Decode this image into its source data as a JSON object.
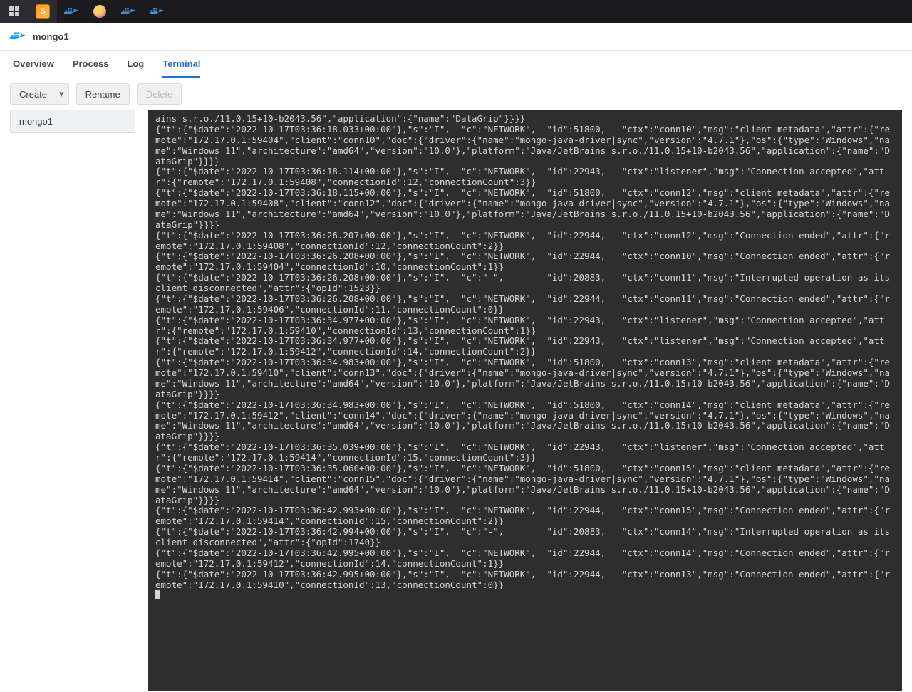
{
  "container": {
    "name": "mongo1"
  },
  "tabs": {
    "overview": "Overview",
    "process": "Process",
    "log": "Log",
    "terminal": "Terminal",
    "active": "terminal"
  },
  "toolbar": {
    "create": "Create",
    "rename": "Rename",
    "delete": "Delete"
  },
  "sidebar": {
    "items": [
      "mongo1"
    ]
  },
  "terminal": {
    "lines": [
      "ains s.r.o./11.0.15+10-b2043.56\",\"application\":{\"name\":\"DataGrip\"}}}}",
      "{\"t\":{\"$date\":\"2022-10-17T03:36:18.033+00:00\"},\"s\":\"I\",  \"c\":\"NETWORK\",  \"id\":51800,   \"ctx\":\"conn10\",\"msg\":\"client metadata\",\"attr\":{\"remote\":\"172.17.0.1:59404\",\"client\":\"conn10\",\"doc\":{\"driver\":{\"name\":\"mongo-java-driver|sync\",\"version\":\"4.7.1\"},\"os\":{\"type\":\"Windows\",\"name\":\"Windows 11\",\"architecture\":\"amd64\",\"version\":\"10.0\"},\"platform\":\"Java/JetBrains s.r.o./11.0.15+10-b2043.56\",\"application\":{\"name\":\"DataGrip\"}}}}",
      "{\"t\":{\"$date\":\"2022-10-17T03:36:18.114+00:00\"},\"s\":\"I\",  \"c\":\"NETWORK\",  \"id\":22943,   \"ctx\":\"listener\",\"msg\":\"Connection accepted\",\"attr\":{\"remote\":\"172.17.0.1:59408\",\"connectionId\":12,\"connectionCount\":3}}",
      "{\"t\":{\"$date\":\"2022-10-17T03:36:18.115+00:00\"},\"s\":\"I\",  \"c\":\"NETWORK\",  \"id\":51800,   \"ctx\":\"conn12\",\"msg\":\"client metadata\",\"attr\":{\"remote\":\"172.17.0.1:59408\",\"client\":\"conn12\",\"doc\":{\"driver\":{\"name\":\"mongo-java-driver|sync\",\"version\":\"4.7.1\"},\"os\":{\"type\":\"Windows\",\"name\":\"Windows 11\",\"architecture\":\"amd64\",\"version\":\"10.0\"},\"platform\":\"Java/JetBrains s.r.o./11.0.15+10-b2043.56\",\"application\":{\"name\":\"DataGrip\"}}}}",
      "{\"t\":{\"$date\":\"2022-10-17T03:36:26.207+00:00\"},\"s\":\"I\",  \"c\":\"NETWORK\",  \"id\":22944,   \"ctx\":\"conn12\",\"msg\":\"Connection ended\",\"attr\":{\"remote\":\"172.17.0.1:59408\",\"connectionId\":12,\"connectionCount\":2}}",
      "{\"t\":{\"$date\":\"2022-10-17T03:36:26.208+00:00\"},\"s\":\"I\",  \"c\":\"NETWORK\",  \"id\":22944,   \"ctx\":\"conn10\",\"msg\":\"Connection ended\",\"attr\":{\"remote\":\"172.17.0.1:59404\",\"connectionId\":10,\"connectionCount\":1}}",
      "{\"t\":{\"$date\":\"2022-10-17T03:36:26.208+00:00\"},\"s\":\"I\",  \"c\":\"-\",        \"id\":20883,   \"ctx\":\"conn11\",\"msg\":\"Interrupted operation as its client disconnected\",\"attr\":{\"opId\":1523}}",
      "{\"t\":{\"$date\":\"2022-10-17T03:36:26.208+00:00\"},\"s\":\"I\",  \"c\":\"NETWORK\",  \"id\":22944,   \"ctx\":\"conn11\",\"msg\":\"Connection ended\",\"attr\":{\"remote\":\"172.17.0.1:59406\",\"connectionId\":11,\"connectionCount\":0}}",
      "{\"t\":{\"$date\":\"2022-10-17T03:36:34.977+00:00\"},\"s\":\"I\",  \"c\":\"NETWORK\",  \"id\":22943,   \"ctx\":\"listener\",\"msg\":\"Connection accepted\",\"attr\":{\"remote\":\"172.17.0.1:59410\",\"connectionId\":13,\"connectionCount\":1}}",
      "{\"t\":{\"$date\":\"2022-10-17T03:36:34.977+00:00\"},\"s\":\"I\",  \"c\":\"NETWORK\",  \"id\":22943,   \"ctx\":\"listener\",\"msg\":\"Connection accepted\",\"attr\":{\"remote\":\"172.17.0.1:59412\",\"connectionId\":14,\"connectionCount\":2}}",
      "{\"t\":{\"$date\":\"2022-10-17T03:36:34.983+00:00\"},\"s\":\"I\",  \"c\":\"NETWORK\",  \"id\":51800,   \"ctx\":\"conn13\",\"msg\":\"client metadata\",\"attr\":{\"remote\":\"172.17.0.1:59410\",\"client\":\"conn13\",\"doc\":{\"driver\":{\"name\":\"mongo-java-driver|sync\",\"version\":\"4.7.1\"},\"os\":{\"type\":\"Windows\",\"name\":\"Windows 11\",\"architecture\":\"amd64\",\"version\":\"10.0\"},\"platform\":\"Java/JetBrains s.r.o./11.0.15+10-b2043.56\",\"application\":{\"name\":\"DataGrip\"}}}}",
      "{\"t\":{\"$date\":\"2022-10-17T03:36:34.983+00:00\"},\"s\":\"I\",  \"c\":\"NETWORK\",  \"id\":51800,   \"ctx\":\"conn14\",\"msg\":\"client metadata\",\"attr\":{\"remote\":\"172.17.0.1:59412\",\"client\":\"conn14\",\"doc\":{\"driver\":{\"name\":\"mongo-java-driver|sync\",\"version\":\"4.7.1\"},\"os\":{\"type\":\"Windows\",\"name\":\"Windows 11\",\"architecture\":\"amd64\",\"version\":\"10.0\"},\"platform\":\"Java/JetBrains s.r.o./11.0.15+10-b2043.56\",\"application\":{\"name\":\"DataGrip\"}}}}",
      "{\"t\":{\"$date\":\"2022-10-17T03:36:35.039+00:00\"},\"s\":\"I\",  \"c\":\"NETWORK\",  \"id\":22943,   \"ctx\":\"listener\",\"msg\":\"Connection accepted\",\"attr\":{\"remote\":\"172.17.0.1:59414\",\"connectionId\":15,\"connectionCount\":3}}",
      "{\"t\":{\"$date\":\"2022-10-17T03:36:35.060+00:00\"},\"s\":\"I\",  \"c\":\"NETWORK\",  \"id\":51800,   \"ctx\":\"conn15\",\"msg\":\"client metadata\",\"attr\":{\"remote\":\"172.17.0.1:59414\",\"client\":\"conn15\",\"doc\":{\"driver\":{\"name\":\"mongo-java-driver|sync\",\"version\":\"4.7.1\"},\"os\":{\"type\":\"Windows\",\"name\":\"Windows 11\",\"architecture\":\"amd64\",\"version\":\"10.0\"},\"platform\":\"Java/JetBrains s.r.o./11.0.15+10-b2043.56\",\"application\":{\"name\":\"DataGrip\"}}}}",
      "{\"t\":{\"$date\":\"2022-10-17T03:36:42.993+00:00\"},\"s\":\"I\",  \"c\":\"NETWORK\",  \"id\":22944,   \"ctx\":\"conn15\",\"msg\":\"Connection ended\",\"attr\":{\"remote\":\"172.17.0.1:59414\",\"connectionId\":15,\"connectionCount\":2}}",
      "{\"t\":{\"$date\":\"2022-10-17T03:36:42.994+00:00\"},\"s\":\"I\",  \"c\":\"-\",        \"id\":20883,   \"ctx\":\"conn14\",\"msg\":\"Interrupted operation as its client disconnected\",\"attr\":{\"opId\":1740}}",
      "{\"t\":{\"$date\":\"2022-10-17T03:36:42.995+00:00\"},\"s\":\"I\",  \"c\":\"NETWORK\",  \"id\":22944,   \"ctx\":\"conn14\",\"msg\":\"Connection ended\",\"attr\":{\"remote\":\"172.17.0.1:59412\",\"connectionId\":14,\"connectionCount\":1}}",
      "{\"t\":{\"$date\":\"2022-10-17T03:36:42.995+00:00\"},\"s\":\"I\",  \"c\":\"NETWORK\",  \"id\":22944,   \"ctx\":\"conn13\",\"msg\":\"Connection ended\",\"attr\":{\"remote\":\"172.17.0.1:59410\",\"connectionId\":13,\"connectionCount\":0}}"
    ]
  }
}
